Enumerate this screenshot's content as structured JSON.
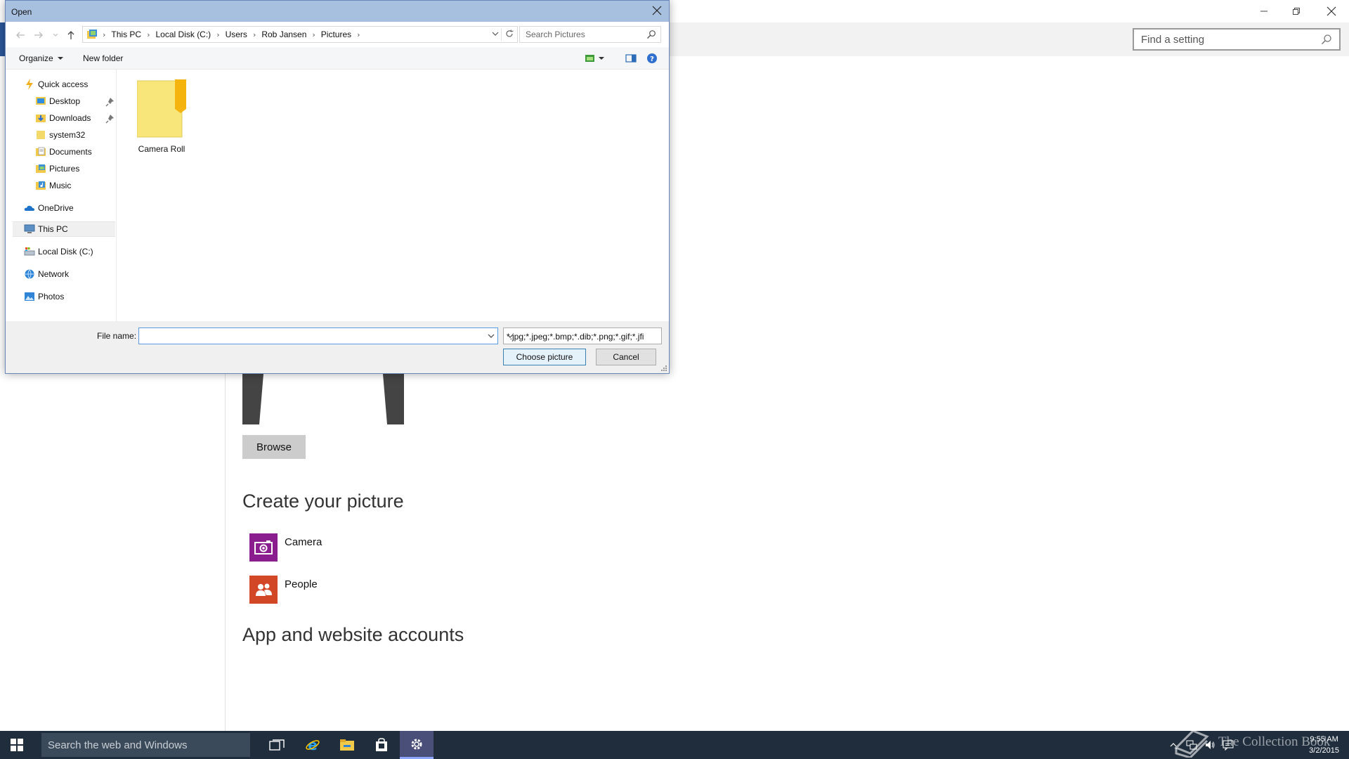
{
  "dialog": {
    "title": "Open",
    "breadcrumb": [
      "This PC",
      "Local Disk (C:)",
      "Users",
      "Rob Jansen",
      "Pictures"
    ],
    "search_placeholder": "Search Pictures",
    "toolbar": {
      "organize_label": "Organize",
      "new_folder_label": "New folder"
    },
    "nav": {
      "quick_access": "Quick access",
      "quick_items": [
        {
          "label": "Desktop",
          "icon": "desktop-icon",
          "pinned": true
        },
        {
          "label": "Downloads",
          "icon": "downloads-icon",
          "pinned": true
        },
        {
          "label": "system32",
          "icon": "folder-icon",
          "pinned": false
        },
        {
          "label": "Documents",
          "icon": "documents-icon",
          "pinned": false
        },
        {
          "label": "Pictures",
          "icon": "pictures-icon",
          "pinned": false
        },
        {
          "label": "Music",
          "icon": "music-icon",
          "pinned": false
        }
      ],
      "onedrive": "OneDrive",
      "this_pc": "This PC",
      "local_disk": "Local Disk (C:)",
      "network": "Network",
      "photos": "Photos"
    },
    "items": [
      {
        "label": "Camera Roll",
        "icon": "folder-icon"
      }
    ],
    "file_name_label": "File name:",
    "file_name_value": "",
    "file_type_value": "*.jpg;*.jpeg;*.bmp;*.dib;*.png;*.gif;*.jfif",
    "choose_label": "Choose picture",
    "cancel_label": "Cancel"
  },
  "settings": {
    "search_placeholder": "Find a setting",
    "browse_label": "Browse",
    "create_heading": "Create your picture",
    "create_items": [
      {
        "label": "Camera",
        "icon": "camera-icon",
        "color": "#8b1e8e"
      },
      {
        "label": "People",
        "icon": "people-icon",
        "color": "#d24726"
      }
    ],
    "accounts_heading": "App and website accounts"
  },
  "taskbar": {
    "search_placeholder": "Search the web and Windows",
    "apps": [
      "task-view-icon",
      "internet-explorer-icon",
      "file-explorer-icon",
      "store-icon",
      "settings-icon"
    ],
    "time": "9:55 AM",
    "date": "3/2/2015",
    "watermark": "The Collection Book"
  },
  "colors": {
    "dialog_titlebar": "#a8c0e0",
    "taskbar": "#1f2d3d",
    "accent": "#2b579a",
    "folder_yellow": "#f8e67a"
  }
}
